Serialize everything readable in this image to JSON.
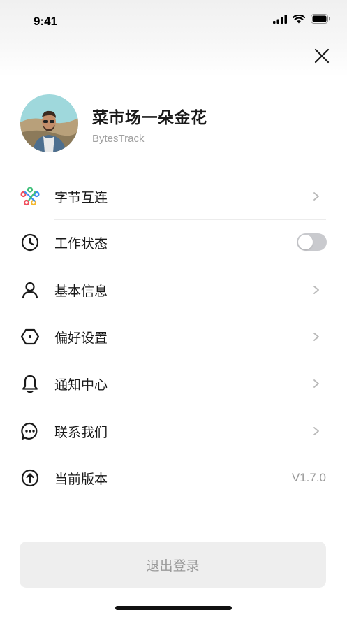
{
  "status_bar": {
    "time": "9:41"
  },
  "profile": {
    "name": "菜市场一朵金花",
    "subtitle": "BytesTrack"
  },
  "menu": {
    "items": [
      {
        "label": "字节互连",
        "icon": "colorful-link-icon",
        "trailing": "chevron"
      },
      {
        "label": "工作状态",
        "icon": "clock-icon",
        "trailing": "toggle",
        "toggle_on": false
      },
      {
        "label": "基本信息",
        "icon": "user-icon",
        "trailing": "chevron"
      },
      {
        "label": "偏好设置",
        "icon": "hexagon-settings-icon",
        "trailing": "chevron"
      },
      {
        "label": "通知中心",
        "icon": "bell-icon",
        "trailing": "chevron"
      },
      {
        "label": "联系我们",
        "icon": "chat-bubble-icon",
        "trailing": "chevron"
      },
      {
        "label": "当前版本",
        "icon": "arrow-up-circle-icon",
        "trailing": "value",
        "value": "V1.7.0"
      }
    ]
  },
  "logout": {
    "label": "退出登录"
  },
  "colors": {
    "accent_green": "#3fc07a",
    "accent_blue": "#3b8ff5",
    "accent_red": "#f04e5e",
    "accent_yellow": "#f5b82e",
    "toggle_off": "#c9cace",
    "logout_bg": "#eeeeee"
  }
}
